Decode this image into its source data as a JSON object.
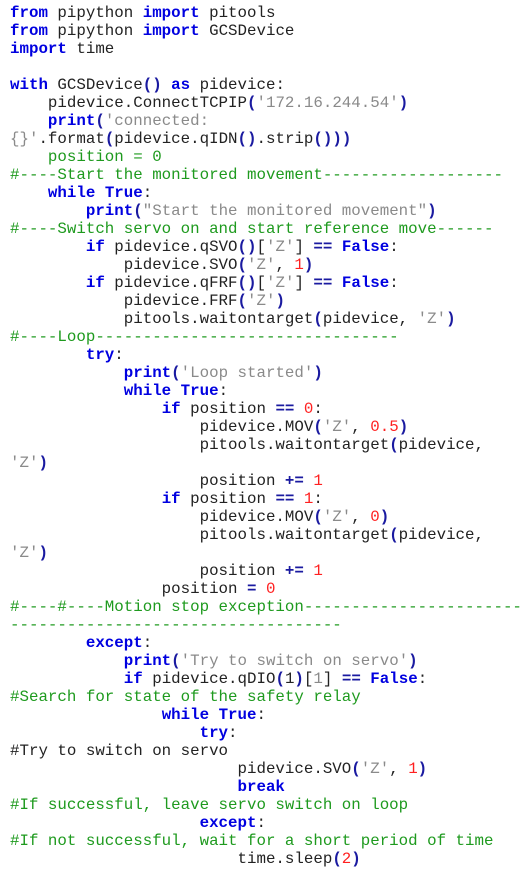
{
  "colors": {
    "keyword": "#0000e0",
    "string": "#8a8a8a",
    "number": "#ff2020",
    "comment": "#1e9a1e",
    "text": "#222222",
    "background": "#ffffff"
  },
  "lines": [
    [
      {
        "t": "kw",
        "v": "from"
      },
      {
        "t": "pl",
        "v": " pipython "
      },
      {
        "t": "kw",
        "v": "import"
      },
      {
        "t": "pl",
        "v": " pitools"
      }
    ],
    [
      {
        "t": "kw",
        "v": "from"
      },
      {
        "t": "pl",
        "v": " pipython "
      },
      {
        "t": "kw",
        "v": "import"
      },
      {
        "t": "pl",
        "v": " GCSDevice"
      }
    ],
    [
      {
        "t": "kw",
        "v": "import"
      },
      {
        "t": "pl",
        "v": " time"
      }
    ],
    [],
    [
      {
        "t": "kw",
        "v": "with"
      },
      {
        "t": "pl",
        "v": " GCSDevice"
      },
      {
        "t": "op",
        "v": "()"
      },
      {
        "t": "pl",
        "v": " "
      },
      {
        "t": "kw",
        "v": "as"
      },
      {
        "t": "pl",
        "v": " pidevice:"
      }
    ],
    [
      {
        "t": "pl",
        "v": "    pidevice.ConnectTCPIP"
      },
      {
        "t": "op",
        "v": "("
      },
      {
        "t": "str",
        "v": "'172.16.244.54'"
      },
      {
        "t": "op",
        "v": ")"
      }
    ],
    [
      {
        "t": "pl",
        "v": "    "
      },
      {
        "t": "kw",
        "v": "print"
      },
      {
        "t": "op",
        "v": "("
      },
      {
        "t": "str",
        "v": "'connected:"
      }
    ],
    [
      {
        "t": "str",
        "v": "{}'"
      },
      {
        "t": "pl",
        "v": ".format"
      },
      {
        "t": "op",
        "v": "("
      },
      {
        "t": "pl",
        "v": "pidevice.qIDN"
      },
      {
        "t": "op",
        "v": "()"
      },
      {
        "t": "pl",
        "v": ".strip"
      },
      {
        "t": "op",
        "v": "()))"
      }
    ],
    [
      {
        "t": "grn",
        "v": "    position = 0"
      }
    ],
    [
      {
        "t": "cm",
        "v": "#----Start the monitored movement-------------------"
      }
    ],
    [
      {
        "t": "pl",
        "v": "    "
      },
      {
        "t": "kw",
        "v": "while"
      },
      {
        "t": "pl",
        "v": " "
      },
      {
        "t": "kw",
        "v": "True"
      },
      {
        "t": "pl",
        "v": ":"
      }
    ],
    [
      {
        "t": "pl",
        "v": "        "
      },
      {
        "t": "kw",
        "v": "print"
      },
      {
        "t": "op",
        "v": "("
      },
      {
        "t": "str",
        "v": "\"Start the monitored movement\""
      },
      {
        "t": "op",
        "v": ")"
      }
    ],
    [
      {
        "t": "cm",
        "v": "#----Switch servo on and start reference move------"
      }
    ],
    [
      {
        "t": "pl",
        "v": "        "
      },
      {
        "t": "kw",
        "v": "if"
      },
      {
        "t": "pl",
        "v": " pidevice.qSVO"
      },
      {
        "t": "op",
        "v": "()"
      },
      {
        "t": "pl",
        "v": "["
      },
      {
        "t": "str",
        "v": "'Z'"
      },
      {
        "t": "pl",
        "v": "] "
      },
      {
        "t": "op",
        "v": "=="
      },
      {
        "t": "pl",
        "v": " "
      },
      {
        "t": "kw",
        "v": "False"
      },
      {
        "t": "pl",
        "v": ":"
      }
    ],
    [
      {
        "t": "pl",
        "v": "            pidevice.SVO"
      },
      {
        "t": "op",
        "v": "("
      },
      {
        "t": "str",
        "v": "'Z'"
      },
      {
        "t": "pl",
        "v": ", "
      },
      {
        "t": "num",
        "v": "1"
      },
      {
        "t": "op",
        "v": ")"
      }
    ],
    [
      {
        "t": "pl",
        "v": "        "
      },
      {
        "t": "kw",
        "v": "if"
      },
      {
        "t": "pl",
        "v": " pidevice.qFRF"
      },
      {
        "t": "op",
        "v": "()"
      },
      {
        "t": "pl",
        "v": "["
      },
      {
        "t": "str",
        "v": "'Z'"
      },
      {
        "t": "pl",
        "v": "] "
      },
      {
        "t": "op",
        "v": "=="
      },
      {
        "t": "pl",
        "v": " "
      },
      {
        "t": "kw",
        "v": "False"
      },
      {
        "t": "pl",
        "v": ":"
      }
    ],
    [
      {
        "t": "pl",
        "v": "            pidevice.FRF"
      },
      {
        "t": "op",
        "v": "("
      },
      {
        "t": "str",
        "v": "'Z'"
      },
      {
        "t": "op",
        "v": ")"
      }
    ],
    [
      {
        "t": "pl",
        "v": "            pitools.waitontarget"
      },
      {
        "t": "op",
        "v": "("
      },
      {
        "t": "pl",
        "v": "pidevice, "
      },
      {
        "t": "str",
        "v": "'Z'"
      },
      {
        "t": "op",
        "v": ")"
      }
    ],
    [
      {
        "t": "cm",
        "v": "#----Loop--------------------------------"
      }
    ],
    [
      {
        "t": "pl",
        "v": "        "
      },
      {
        "t": "kw",
        "v": "try"
      },
      {
        "t": "pl",
        "v": ":"
      }
    ],
    [
      {
        "t": "pl",
        "v": "            "
      },
      {
        "t": "kw",
        "v": "print"
      },
      {
        "t": "op",
        "v": "("
      },
      {
        "t": "str",
        "v": "'Loop started'"
      },
      {
        "t": "op",
        "v": ")"
      }
    ],
    [
      {
        "t": "pl",
        "v": "            "
      },
      {
        "t": "kw",
        "v": "while"
      },
      {
        "t": "pl",
        "v": " "
      },
      {
        "t": "kw",
        "v": "True"
      },
      {
        "t": "pl",
        "v": ":"
      }
    ],
    [
      {
        "t": "pl",
        "v": "                "
      },
      {
        "t": "kw",
        "v": "if"
      },
      {
        "t": "pl",
        "v": " position "
      },
      {
        "t": "op",
        "v": "=="
      },
      {
        "t": "pl",
        "v": " "
      },
      {
        "t": "num",
        "v": "0"
      },
      {
        "t": "pl",
        "v": ":"
      }
    ],
    [
      {
        "t": "pl",
        "v": "                    pidevice.MOV"
      },
      {
        "t": "op",
        "v": "("
      },
      {
        "t": "str",
        "v": "'Z'"
      },
      {
        "t": "pl",
        "v": ", "
      },
      {
        "t": "num",
        "v": "0.5"
      },
      {
        "t": "op",
        "v": ")"
      }
    ],
    [
      {
        "t": "pl",
        "v": "                    pitools.waitontarget"
      },
      {
        "t": "op",
        "v": "("
      },
      {
        "t": "pl",
        "v": "pidevice,"
      }
    ],
    [
      {
        "t": "str",
        "v": "'Z'"
      },
      {
        "t": "op",
        "v": ")"
      }
    ],
    [
      {
        "t": "pl",
        "v": "                    position "
      },
      {
        "t": "op",
        "v": "+="
      },
      {
        "t": "pl",
        "v": " "
      },
      {
        "t": "num",
        "v": "1"
      }
    ],
    [
      {
        "t": "pl",
        "v": "                "
      },
      {
        "t": "kw",
        "v": "if"
      },
      {
        "t": "pl",
        "v": " position "
      },
      {
        "t": "op",
        "v": "=="
      },
      {
        "t": "pl",
        "v": " "
      },
      {
        "t": "num",
        "v": "1"
      },
      {
        "t": "pl",
        "v": ":"
      }
    ],
    [
      {
        "t": "pl",
        "v": "                    pidevice.MOV"
      },
      {
        "t": "op",
        "v": "("
      },
      {
        "t": "str",
        "v": "'Z'"
      },
      {
        "t": "pl",
        "v": ", "
      },
      {
        "t": "num",
        "v": "0"
      },
      {
        "t": "op",
        "v": ")"
      }
    ],
    [
      {
        "t": "pl",
        "v": "                    pitools.waitontarget"
      },
      {
        "t": "op",
        "v": "("
      },
      {
        "t": "pl",
        "v": "pidevice,"
      }
    ],
    [
      {
        "t": "str",
        "v": "'Z'"
      },
      {
        "t": "op",
        "v": ")"
      }
    ],
    [
      {
        "t": "pl",
        "v": "                    position "
      },
      {
        "t": "op",
        "v": "+="
      },
      {
        "t": "pl",
        "v": " "
      },
      {
        "t": "num",
        "v": "1"
      }
    ],
    [
      {
        "t": "pl",
        "v": "                position "
      },
      {
        "t": "op",
        "v": "="
      },
      {
        "t": "pl",
        "v": " "
      },
      {
        "t": "num",
        "v": "0"
      }
    ],
    [
      {
        "t": "cm",
        "v": "#----#----Motion stop exception-----------------------"
      }
    ],
    [
      {
        "t": "cm",
        "v": "-----------------------------------"
      }
    ],
    [
      {
        "t": "pl",
        "v": "        "
      },
      {
        "t": "kw",
        "v": "except"
      },
      {
        "t": "pl",
        "v": ":"
      }
    ],
    [
      {
        "t": "pl",
        "v": "            "
      },
      {
        "t": "kw",
        "v": "print"
      },
      {
        "t": "op",
        "v": "("
      },
      {
        "t": "str",
        "v": "'Try to switch on servo'"
      },
      {
        "t": "op",
        "v": ")"
      }
    ],
    [
      {
        "t": "pl",
        "v": "            "
      },
      {
        "t": "kw",
        "v": "if"
      },
      {
        "t": "pl",
        "v": " pidevice.qDIO"
      },
      {
        "t": "op",
        "v": "("
      },
      {
        "t": "pl",
        "v": "1"
      },
      {
        "t": "op",
        "v": ")"
      },
      {
        "t": "pl",
        "v": "["
      },
      {
        "t": "str",
        "v": "1"
      },
      {
        "t": "pl",
        "v": "] "
      },
      {
        "t": "op",
        "v": "=="
      },
      {
        "t": "pl",
        "v": " "
      },
      {
        "t": "kw",
        "v": "False"
      },
      {
        "t": "pl",
        "v": ":"
      }
    ],
    [
      {
        "t": "cm",
        "v": "#Search for state of the safety relay"
      }
    ],
    [
      {
        "t": "pl",
        "v": "                "
      },
      {
        "t": "kw",
        "v": "while"
      },
      {
        "t": "pl",
        "v": " "
      },
      {
        "t": "kw",
        "v": "True"
      },
      {
        "t": "pl",
        "v": ":"
      }
    ],
    [
      {
        "t": "pl",
        "v": "                    "
      },
      {
        "t": "kw",
        "v": "try"
      },
      {
        "t": "pl",
        "v": ":"
      }
    ],
    [
      {
        "t": "pl",
        "v": "#Try to switch on servo"
      }
    ],
    [
      {
        "t": "pl",
        "v": "                        pidevice.SVO"
      },
      {
        "t": "op",
        "v": "("
      },
      {
        "t": "str",
        "v": "'Z'"
      },
      {
        "t": "pl",
        "v": ", "
      },
      {
        "t": "num",
        "v": "1"
      },
      {
        "t": "op",
        "v": ")"
      }
    ],
    [
      {
        "t": "pl",
        "v": "                        "
      },
      {
        "t": "kw",
        "v": "break"
      }
    ],
    [
      {
        "t": "cm",
        "v": "#If successful, leave servo switch on loop"
      }
    ],
    [
      {
        "t": "pl",
        "v": "                    "
      },
      {
        "t": "kw",
        "v": "except"
      },
      {
        "t": "pl",
        "v": ":"
      }
    ],
    [
      {
        "t": "cm",
        "v": "#If not successful, wait for a short period of time"
      }
    ],
    [
      {
        "t": "pl",
        "v": "                        time.sleep"
      },
      {
        "t": "op",
        "v": "("
      },
      {
        "t": "num",
        "v": "2"
      },
      {
        "t": "op",
        "v": ")"
      }
    ]
  ]
}
